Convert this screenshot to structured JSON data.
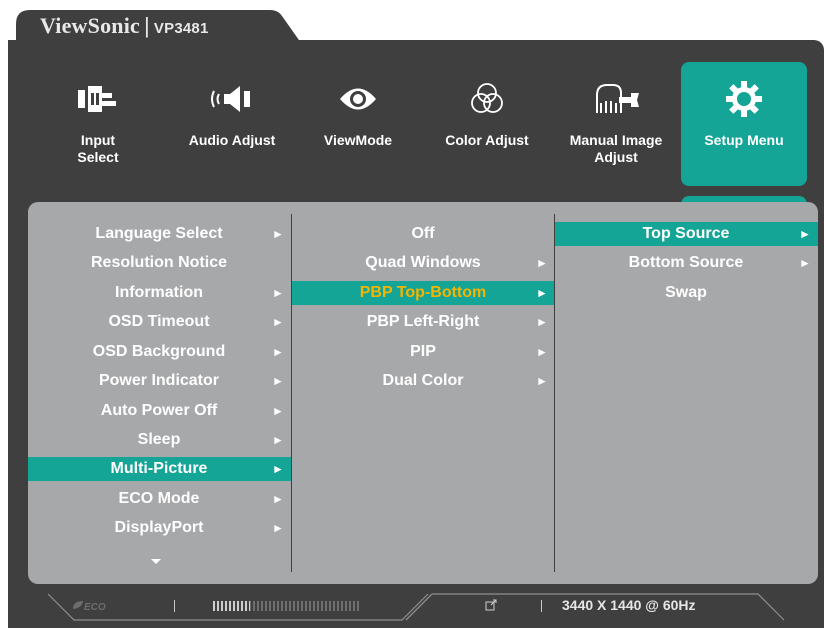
{
  "header": {
    "brand": "ViewSonic",
    "separator": "|",
    "model": "VP3481"
  },
  "top_menu": [
    {
      "label": "Input\nSelect",
      "icon": "input-select-icon"
    },
    {
      "label": "Audio Adjust",
      "icon": "speaker-icon"
    },
    {
      "label": "ViewMode",
      "icon": "eye-icon"
    },
    {
      "label": "Color Adjust",
      "icon": "color-circles-icon"
    },
    {
      "label": "Manual Image\nAdjust",
      "icon": "hand-wrench-icon"
    },
    {
      "label": "Setup Menu",
      "icon": "gear-icon",
      "active": true
    }
  ],
  "menu_col1": [
    {
      "label": "Language Select",
      "arrow": "►"
    },
    {
      "label": "Resolution Notice",
      "arrow": ""
    },
    {
      "label": "Information",
      "arrow": "►"
    },
    {
      "label": "OSD Timeout",
      "arrow": "►"
    },
    {
      "label": "OSD Background",
      "arrow": "►"
    },
    {
      "label": "Power Indicator",
      "arrow": "►"
    },
    {
      "label": "Auto Power Off",
      "arrow": "►"
    },
    {
      "label": "Sleep",
      "arrow": "►"
    },
    {
      "label": "Multi-Picture",
      "arrow": "►",
      "selected": true
    },
    {
      "label": "ECO Mode",
      "arrow": "►"
    },
    {
      "label": "DisplayPort",
      "arrow": "►"
    }
  ],
  "menu_col2": [
    {
      "label": "Off",
      "arrow": ""
    },
    {
      "label": "Quad Windows",
      "arrow": "►"
    },
    {
      "label": "PBP Top-Bottom",
      "arrow": "►",
      "selected": true
    },
    {
      "label": "PBP Left-Right",
      "arrow": "►"
    },
    {
      "label": "PIP",
      "arrow": "►"
    },
    {
      "label": "Dual Color",
      "arrow": "►"
    }
  ],
  "menu_col3": [
    {
      "label": "Top Source",
      "arrow": "►",
      "selected": true
    },
    {
      "label": "Bottom Source",
      "arrow": "►"
    },
    {
      "label": "Swap",
      "arrow": ""
    }
  ],
  "status": {
    "eco_label": "ECO",
    "level": 0.25,
    "resolution": "3440 X 1440 @ 60Hz"
  },
  "colors": {
    "accent": "#14a597",
    "frame": "#3f3f40",
    "panel": "#a7a8aa",
    "highlight_text": "#f4b400"
  }
}
